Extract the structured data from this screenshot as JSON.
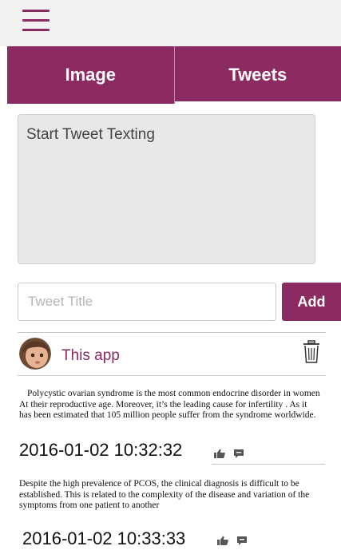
{
  "menu": {
    "icon": "hamburger-menu-icon"
  },
  "tabs": [
    {
      "label": "Image",
      "active": false
    },
    {
      "label": "Tweets",
      "active": true
    }
  ],
  "composer": {
    "text_placeholder": "Start Tweet Texting",
    "title_placeholder": "Tweet Title",
    "add_label": "Add"
  },
  "feed": {
    "author": "This app",
    "delete_icon": "trash-icon",
    "tweets": [
      {
        "body": "Polycystic ovarian syndrome is the most common endocrine disorder in women At their reproductive age. Moreover, it’s the leading cause for infertility . As it has been estimated that 105 million people suffer from the syndrome worldwide.",
        "timestamp": "2016-01-02 10:32:32"
      },
      {
        "body": "Despite the high prevalence of PCOS, the clinical diagnosis is difficult to be established. This is related to the complexity of the disease and variation of the symptoms from one patient to another",
        "timestamp": "2016-01-02 10:33:33"
      }
    ]
  },
  "colors": {
    "accent": "#8c2a62",
    "topbar": "#f2f2f2",
    "textarea": "#e8e8e8"
  }
}
